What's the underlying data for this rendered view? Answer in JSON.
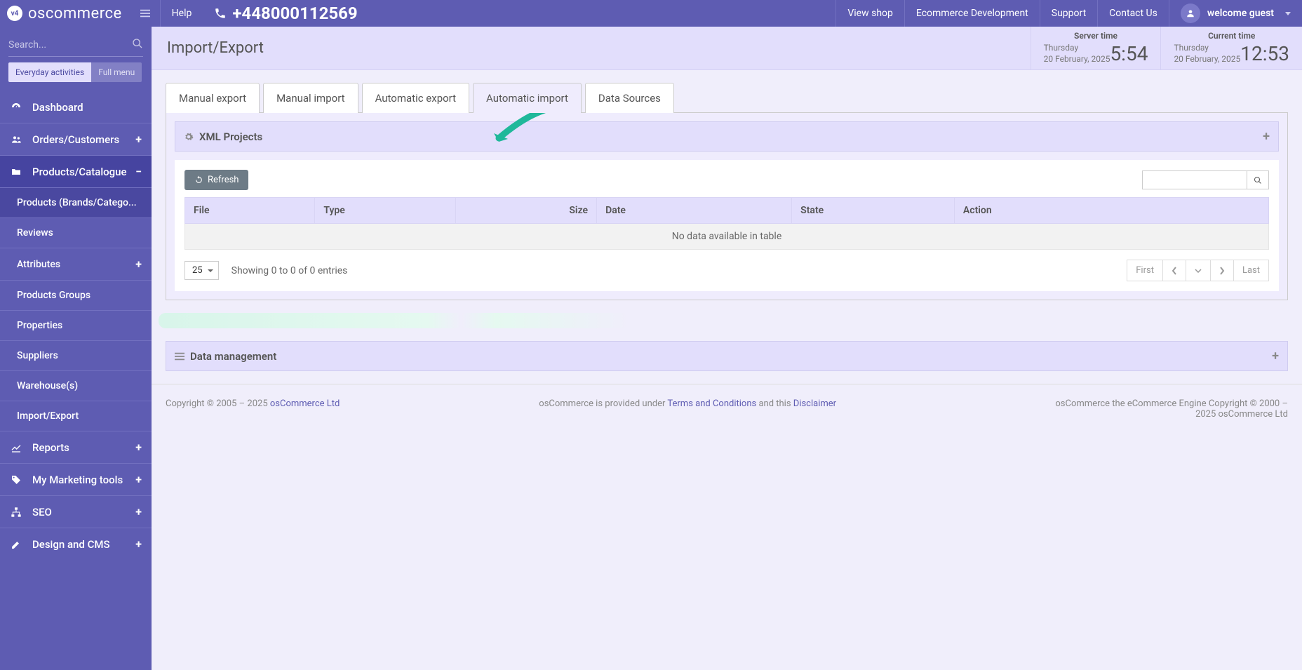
{
  "brand": "oscommerce",
  "top": {
    "help": "Help",
    "phone": "+448000112569",
    "links": [
      "View shop",
      "Ecommerce Development",
      "Support",
      "Contact Us"
    ],
    "welcome": "welcome guest"
  },
  "sidebar": {
    "search_placeholder": "Search...",
    "btn_everyday": "Everyday activities",
    "btn_full": "Full menu",
    "items": [
      {
        "label": "Dashboard"
      },
      {
        "label": "Orders/Customers",
        "toggle": "+"
      },
      {
        "label": "Products/Catalogue",
        "toggle": "−",
        "active": true,
        "children": [
          {
            "label": "Products (Brands/Catego...",
            "selected": true
          },
          {
            "label": "Reviews"
          },
          {
            "label": "Attributes",
            "toggle": "+"
          },
          {
            "label": "Products Groups"
          },
          {
            "label": "Properties"
          },
          {
            "label": "Suppliers"
          },
          {
            "label": "Warehouse(s)"
          },
          {
            "label": "Import/Export"
          }
        ]
      },
      {
        "label": "Reports",
        "toggle": "+"
      },
      {
        "label": "My Marketing tools",
        "toggle": "+"
      },
      {
        "label": "SEO",
        "toggle": "+"
      },
      {
        "label": "Design and CMS",
        "toggle": "+"
      }
    ]
  },
  "page": {
    "title": "Import/Export",
    "server_time": {
      "label": "Server time",
      "day": "Thursday",
      "date": "20 February, 2025",
      "time": "5:54"
    },
    "current_time": {
      "label": "Current time",
      "day": "Thursday",
      "date": "20 February, 2025",
      "time": "12:53"
    }
  },
  "tabs": [
    "Manual export",
    "Manual import",
    "Automatic export",
    "Automatic import",
    "Data Sources"
  ],
  "active_tab_index": 3,
  "widget": {
    "title": "XML Projects",
    "refresh": "Refresh",
    "columns": [
      "File",
      "Type",
      "Size",
      "Date",
      "State",
      "Action"
    ],
    "empty": "No data available in table",
    "page_size": "25",
    "showing": "Showing 0 to 0 of 0 entries",
    "pager": {
      "first": "First",
      "last": "Last"
    }
  },
  "widget2": {
    "title": "Data management"
  },
  "footer": {
    "left_a": "Copyright © 2005 – 2025 ",
    "left_link": "osCommerce Ltd",
    "mid_a": "osCommerce is provided under ",
    "mid_link1": "Terms and Conditions",
    "mid_b": " and this ",
    "mid_link2": "Disclaimer",
    "right": "osCommerce the eCommerce Engine Copyright © 2000 – 2025 osCommerce Ltd"
  }
}
